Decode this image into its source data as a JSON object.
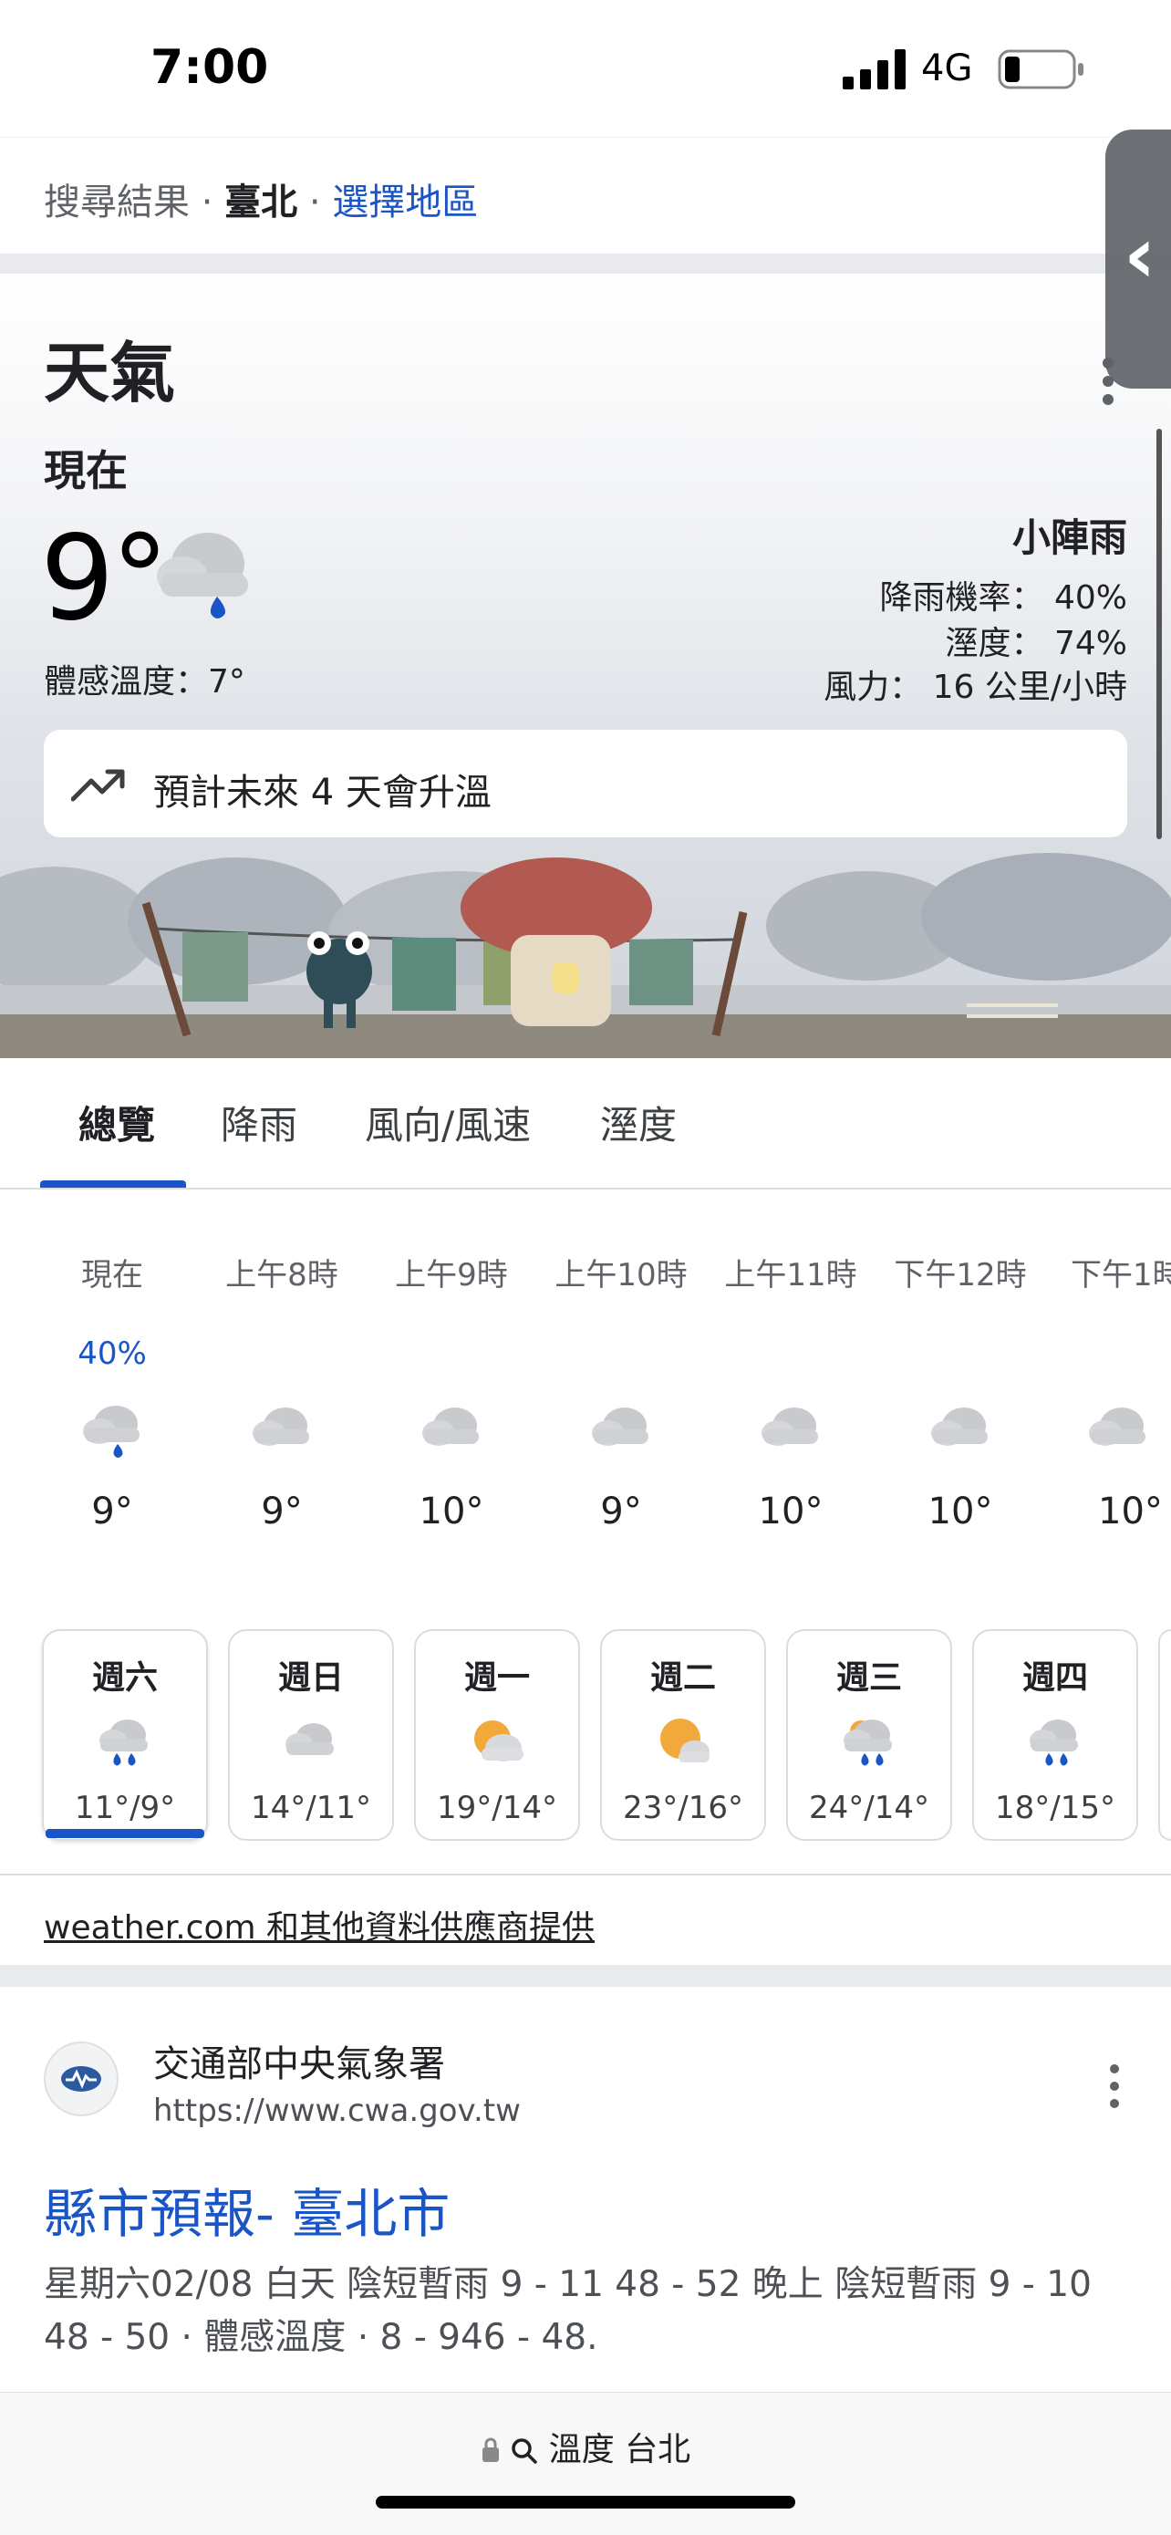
{
  "status_bar": {
    "time": "7:00",
    "network": "4G"
  },
  "breadcrumb": {
    "search_results": "搜尋結果",
    "city": "臺北",
    "choose_region": "選擇地區"
  },
  "weather": {
    "title": "天氣",
    "now_label": "現在",
    "temperature": "9°",
    "feels_like": "體感溫度：7°",
    "condition": "小陣雨",
    "precip_label": "降雨機率：",
    "precip_value": "40%",
    "humidity_label": "溼度：",
    "humidity_value": "74%",
    "wind_label": "風力：",
    "wind_value": "16 公里/小時",
    "trend_text": "預計未來 4 天會升溫"
  },
  "tabs": [
    {
      "label": "總覽",
      "active": true
    },
    {
      "label": "降雨",
      "active": false
    },
    {
      "label": "風向/風速",
      "active": false
    },
    {
      "label": "溼度",
      "active": false
    }
  ],
  "hourly": [
    {
      "label": "現在",
      "pop": "40%",
      "icon": "rain-cloud-icon",
      "temp": "9°"
    },
    {
      "label": "上午8時",
      "pop": "",
      "icon": "cloud-icon",
      "temp": "9°"
    },
    {
      "label": "上午9時",
      "pop": "",
      "icon": "cloud-icon",
      "temp": "10°"
    },
    {
      "label": "上午10時",
      "pop": "",
      "icon": "cloud-icon",
      "temp": "9°"
    },
    {
      "label": "上午11時",
      "pop": "",
      "icon": "cloud-icon",
      "temp": "10°"
    },
    {
      "label": "下午12時",
      "pop": "",
      "icon": "cloud-icon",
      "temp": "10°"
    },
    {
      "label": "下午1時",
      "pop": "",
      "icon": "cloud-icon",
      "temp": "10°"
    }
  ],
  "daily": [
    {
      "day": "週六",
      "icon": "rain-cloud-icon",
      "range": "11°/9°",
      "selected": true
    },
    {
      "day": "週日",
      "icon": "cloud-icon",
      "range": "14°/11°",
      "selected": false
    },
    {
      "day": "週一",
      "icon": "partly-sunny-icon",
      "range": "19°/14°",
      "selected": false
    },
    {
      "day": "週二",
      "icon": "partly-sunny-icon",
      "range": "23°/16°",
      "selected": false
    },
    {
      "day": "週三",
      "icon": "rain-cloud-icon",
      "range": "24°/14°",
      "selected": false
    },
    {
      "day": "週四",
      "icon": "rain-cloud-icon",
      "range": "18°/15°",
      "selected": false
    }
  ],
  "attribution": "weather.com 和其他資料供應商提供",
  "result": {
    "site_name": "交通部中央氣象署",
    "url": "https://www.cwa.gov.tw",
    "title": "縣市預報- 臺北市",
    "snippet": "星期六02/08 白天 陰短暫雨 9 - 11 48 - 52 晚上 陰短暫雨 9 - 10 48 - 50 · 體感溫度 · 8 - 946 - 48."
  },
  "address_bar": {
    "text": "溫度 台北"
  },
  "colors": {
    "accent": "#1a55c8",
    "rain": "#1a55c8"
  }
}
